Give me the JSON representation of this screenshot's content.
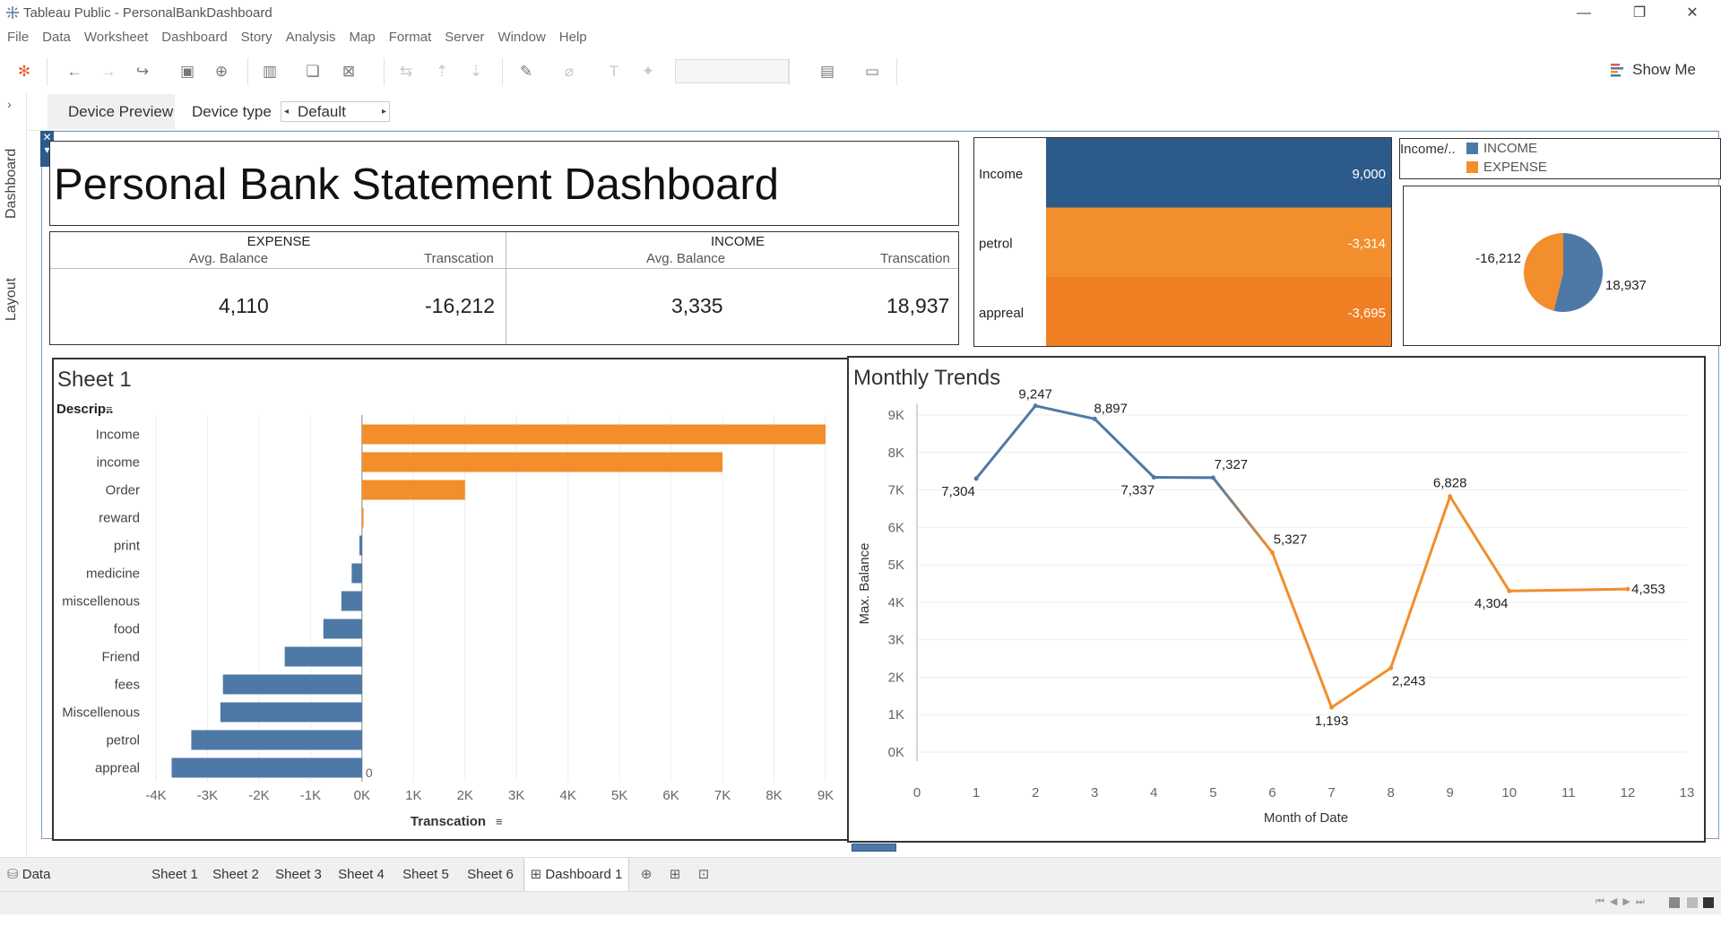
{
  "window": {
    "title": "Tableau Public - PersonalBankDashboard"
  },
  "menu": [
    "File",
    "Data",
    "Worksheet",
    "Dashboard",
    "Story",
    "Analysis",
    "Map",
    "Format",
    "Server",
    "Window",
    "Help"
  ],
  "toolbar": {
    "show_me_label": "Show Me"
  },
  "side_tabs": {
    "dashboard": "Dashboard",
    "layout": "Layout"
  },
  "device_bar": {
    "preview_label": "Device Preview",
    "type_label": "Device type",
    "type_value": "Default"
  },
  "dashboard": {
    "title": "Personal Bank Statement Dashboard",
    "kpi": {
      "expense": {
        "label": "EXPENSE",
        "avg_label": "Avg. Balance",
        "tx_label": "Transcation",
        "avg_value": "4,110",
        "tx_value": "-16,212"
      },
      "income": {
        "label": "INCOME",
        "avg_label": "Avg. Balance",
        "tx_label": "Transcation",
        "avg_value": "3,335",
        "tx_value": "18,937"
      }
    },
    "legend": {
      "title": "Income/..",
      "items": [
        {
          "label": "INCOME",
          "color": "#4e79a7"
        },
        {
          "label": "EXPENSE",
          "color": "#f28e2b"
        }
      ]
    },
    "colors": {
      "income": "#4e79a7",
      "expense": "#f28e2b",
      "heat_income": "#2c5b8b",
      "heat_petrol": "#f28e2b",
      "heat_appreal": "#ef7f22"
    }
  },
  "chart_data": [
    {
      "type": "table",
      "name": "highlight-table",
      "rows": [
        {
          "label": "Income",
          "value": 9000,
          "display": "9,000"
        },
        {
          "label": "petrol",
          "value": -3314,
          "display": "-3,314"
        },
        {
          "label": "appreal",
          "value": -3695,
          "display": "-3,695"
        }
      ]
    },
    {
      "type": "pie",
      "slices": [
        {
          "label": "INCOME",
          "value": 18937,
          "display": "18,937"
        },
        {
          "label": "EXPENSE",
          "value": -16212,
          "display": "-16,212"
        }
      ]
    },
    {
      "type": "bar",
      "orientation": "horizontal",
      "title": "Sheet 1",
      "ylabel": "Descrip..",
      "xlabel": "Transcation",
      "categories": [
        "Income",
        "income",
        "Order",
        "reward",
        "print",
        "medicine",
        "miscellenous",
        "food",
        "Friend",
        "fees",
        "Miscellenous",
        "petrol",
        "appreal"
      ],
      "values": [
        9000,
        7000,
        2000,
        30,
        -50,
        -200,
        -400,
        -750,
        -1500,
        -2700,
        -2750,
        -3314,
        -3695
      ],
      "xlim": [
        -4000,
        9000
      ],
      "xticks": [
        "-4K",
        "-3K",
        "-2K",
        "-1K",
        "0K",
        "1K",
        "2K",
        "3K",
        "4K",
        "5K",
        "6K",
        "7K",
        "8K",
        "9K"
      ],
      "zero_label": "0"
    },
    {
      "type": "line",
      "title": "Monthly Trends",
      "xlabel": "Month of Date",
      "ylabel": "Max. Balance",
      "x": [
        1,
        2,
        3,
        4,
        5,
        6,
        7,
        8,
        9,
        10,
        12
      ],
      "y": [
        7304,
        9247,
        8897,
        7337,
        7327,
        5327,
        1193,
        2243,
        6828,
        4304,
        4353
      ],
      "labels": [
        "7,304",
        "9,247",
        "8,897",
        "7,337",
        "7,327",
        "5,327",
        "1,193",
        "2,243",
        "6,828",
        "4,304",
        "4,353"
      ],
      "xlim": [
        0,
        13
      ],
      "ylim": [
        0,
        9000
      ],
      "xticks": [
        "0",
        "1",
        "2",
        "3",
        "4",
        "5",
        "6",
        "7",
        "8",
        "9",
        "10",
        "11",
        "12",
        "13"
      ],
      "yticks": [
        "0K",
        "1K",
        "2K",
        "3K",
        "4K",
        "5K",
        "6K",
        "7K",
        "8K",
        "9K"
      ]
    }
  ],
  "sheet_tabs": [
    "Data Source",
    "Sheet 1",
    "Sheet 2",
    "Sheet 3",
    "Sheet 4",
    "Sheet 5",
    "Sheet 6",
    "Dashboard 1"
  ],
  "active_tab": "Dashboard 1"
}
